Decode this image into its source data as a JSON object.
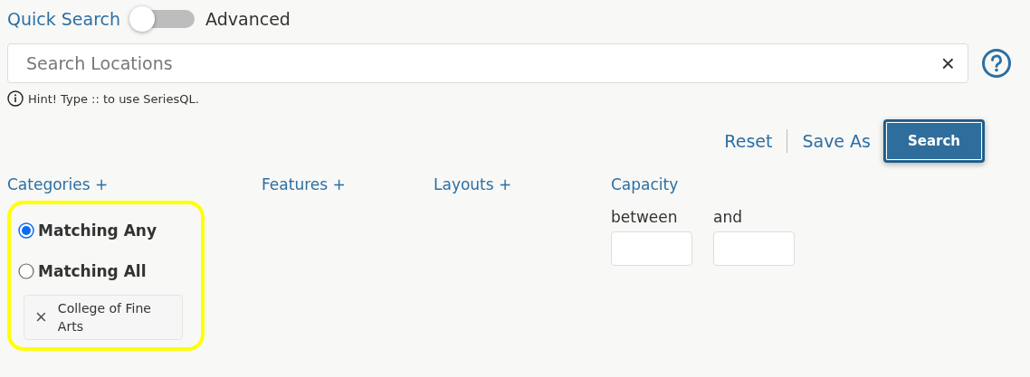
{
  "mode_toggle": {
    "left_label": "Quick Search",
    "right_label": "Advanced",
    "on": false
  },
  "search": {
    "placeholder": "Search Locations",
    "clear": "×"
  },
  "hint": "Hint! Type :: to use SeriesQL.",
  "actions": {
    "reset": "Reset",
    "save_as": "Save As",
    "search": "Search"
  },
  "filters": [
    {
      "kind": "categories",
      "label": "Categories +",
      "highlighted": true,
      "match_options": [
        {
          "label": "Matching Any",
          "selected": true
        },
        {
          "label": "Matching All",
          "selected": false
        }
      ],
      "tags": [
        {
          "label": "College of Fine Arts",
          "remove": "×"
        }
      ]
    },
    {
      "kind": "plain",
      "label": "Features +"
    },
    {
      "kind": "plain",
      "label": "Layouts +"
    },
    {
      "kind": "range",
      "label": "Capacity",
      "from_label": "between",
      "to_label": "and"
    }
  ]
}
